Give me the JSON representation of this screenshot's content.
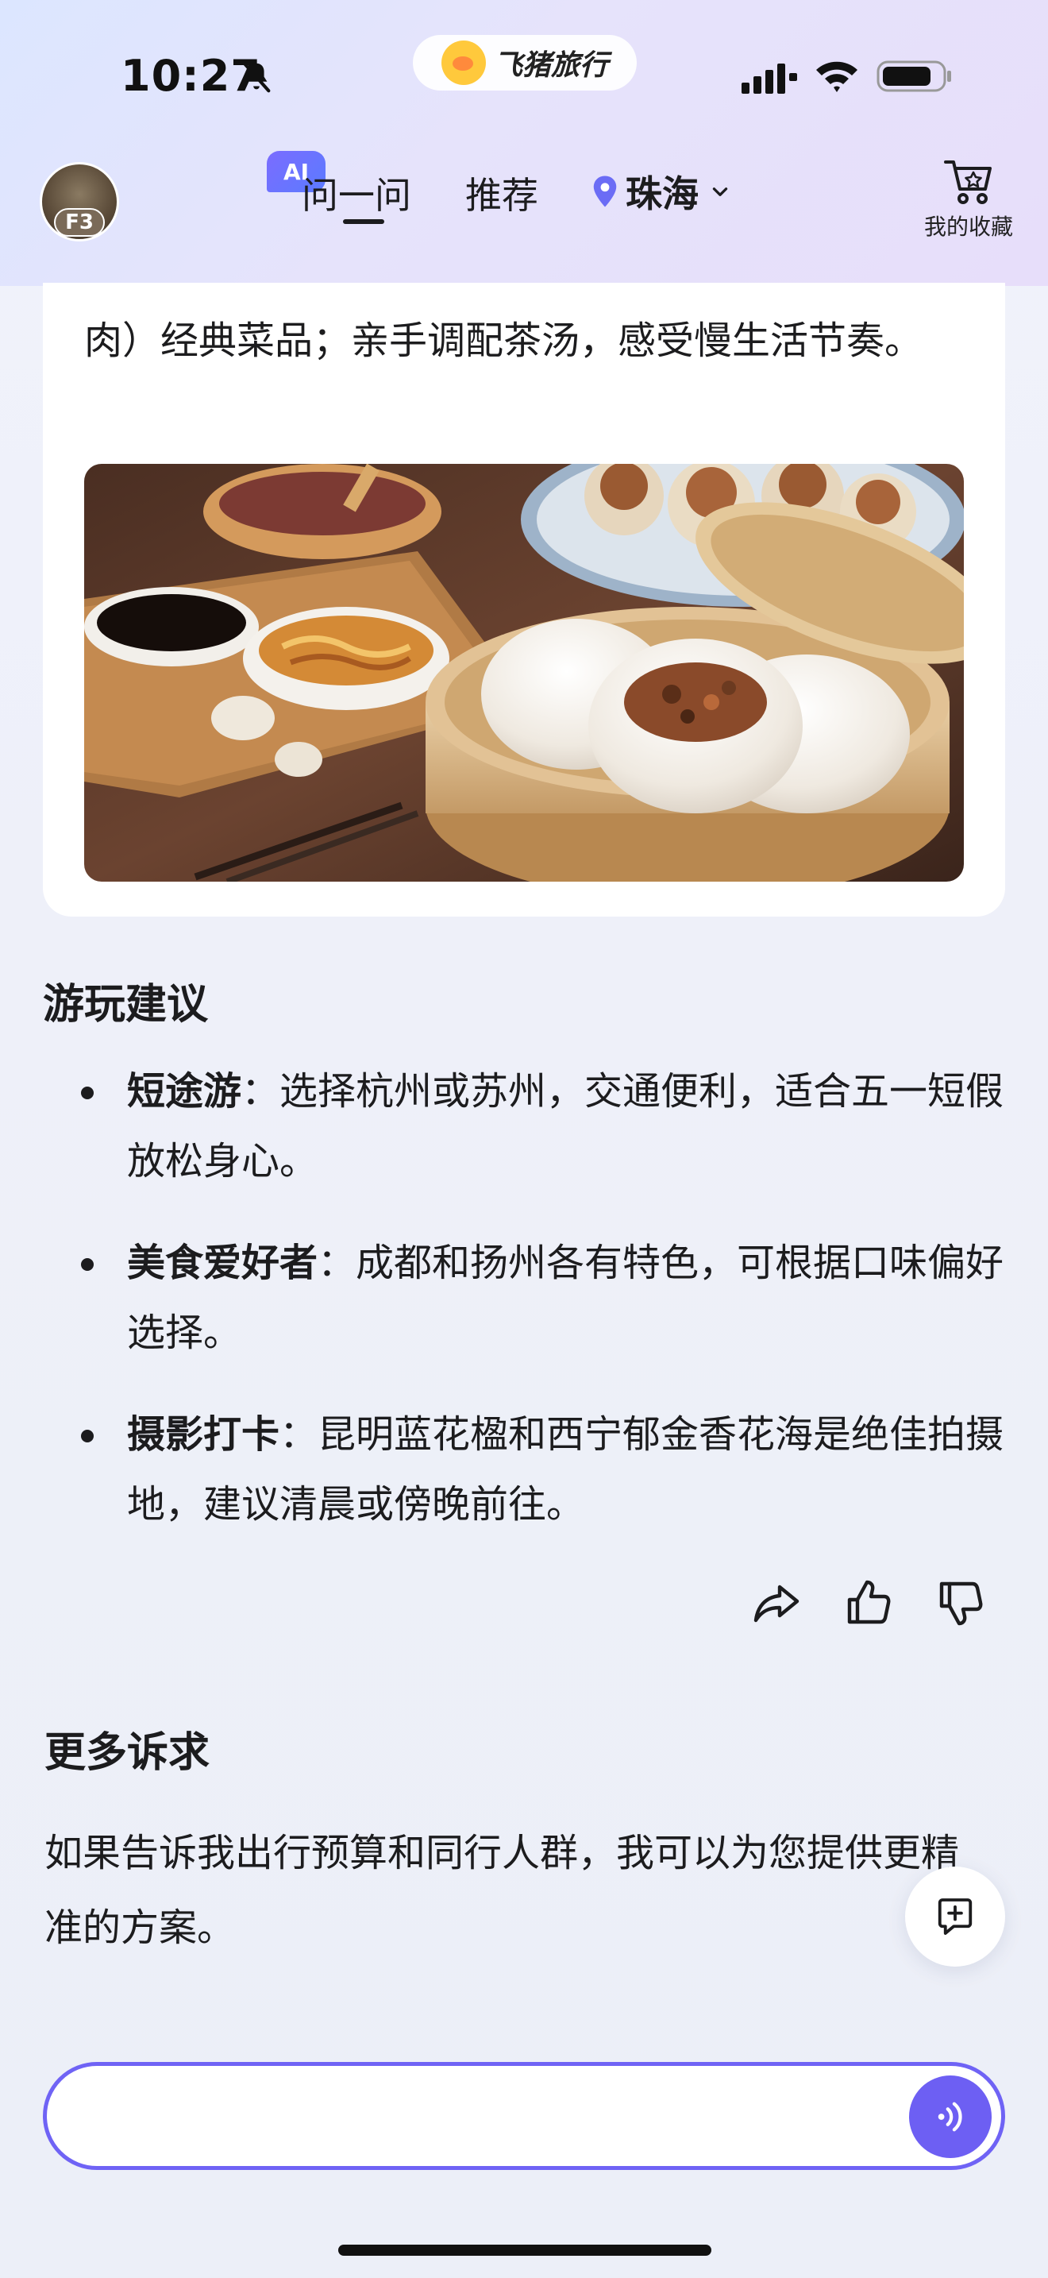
{
  "status_bar": {
    "time": "10:27",
    "app_name": "飞猪旅行"
  },
  "header": {
    "avatar_tag": "F3",
    "ai_badge": "AI",
    "tabs": [
      {
        "label": "问一问",
        "active": true
      },
      {
        "label": "推荐",
        "active": false
      }
    ],
    "location": "珠海",
    "favorites_label": "我的收藏"
  },
  "card": {
    "text": "肉）经典菜品；亲手调配茶汤，感受慢生活节奏。",
    "image_icon": "food-photo"
  },
  "tips": {
    "title": "游玩建议",
    "items": [
      {
        "key": "短途游",
        "sep": "：",
        "text": "选择杭州或苏州，交通便利，适合五一短假放松身心。"
      },
      {
        "key": "美食爱好者",
        "sep": "：",
        "text": "成都和扬州各有特色，可根据口味偏好选择。"
      },
      {
        "key": "摄影打卡",
        "sep": "：",
        "text": "昆明蓝花楹和西宁郁金香花海是绝佳拍摄地，建议清晨或傍晚前往。"
      }
    ]
  },
  "more": {
    "title": "更多诉求",
    "text": "如果告诉我出行预算和同行人群，我可以为您提供更精准的方案。"
  },
  "input": {
    "placeholder": ""
  },
  "colors": {
    "accent": "#6d5ff3",
    "location_pin": "#6b6cf5",
    "text": "#1c1c1e"
  }
}
